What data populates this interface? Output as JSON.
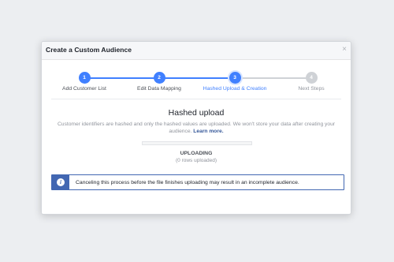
{
  "dialog": {
    "title": "Create a Custom Audience",
    "close_label": "×"
  },
  "stepper": {
    "active_color": "#4080ff",
    "inactive_color": "#cfd2d6",
    "steps": [
      {
        "number": "1",
        "label": "Add Customer List",
        "state": "complete"
      },
      {
        "number": "2",
        "label": "Edit Data Mapping",
        "state": "complete"
      },
      {
        "number": "3",
        "label": "Hashed Upload & Creation",
        "state": "active"
      },
      {
        "number": "4",
        "label": "Next Steps",
        "state": "pending"
      }
    ]
  },
  "upload": {
    "title": "Hashed upload",
    "description": "Customer identifiers are hashed and only the hashed values are uploaded. We won't store your data after creating your audience.",
    "learn_more": "Learn more.",
    "progress_fraction": 0,
    "status": "UPLOADING",
    "rows": "(0 rows uploaded)"
  },
  "notice": {
    "icon": "info-icon",
    "icon_glyph": "i",
    "text": "Canceling this process before the file finishes uploading may result in an incomplete audience."
  }
}
